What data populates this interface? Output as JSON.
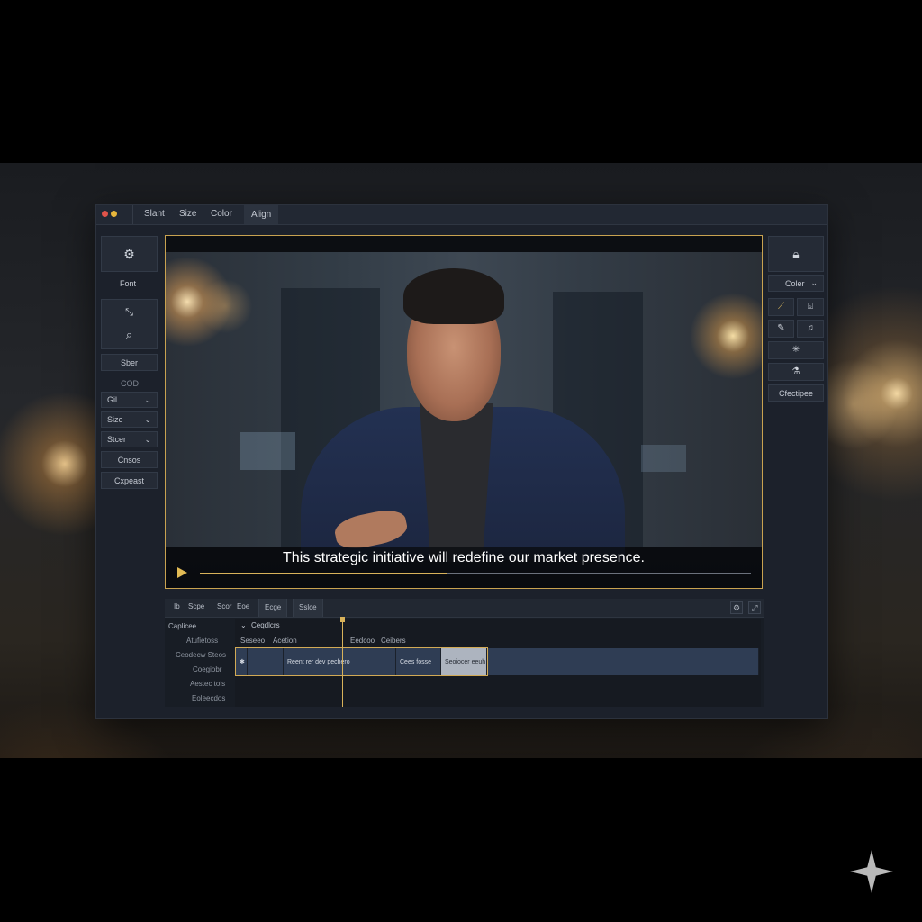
{
  "menu": [
    "Slant",
    "Size",
    "Color",
    "Align"
  ],
  "left_panel": {
    "font_label": "Font",
    "style_button": "Sber",
    "divider_text": "COD",
    "dropdowns": [
      "Gil",
      "Size",
      "Stcer"
    ],
    "cross_button": "Cnsos",
    "export_button": "Cxpeast"
  },
  "video": {
    "caption": "This strategic initiative will redefine our market presence.",
    "progress": 0.45
  },
  "right_panel": {
    "color_label": "Coler",
    "settings_button": "Cfectipee"
  },
  "timeline": {
    "tabs": [
      "Ib",
      "Scpe",
      "Scor",
      "Eoe",
      "Ecge",
      "Sslce"
    ],
    "caption_track": "Ceqdlcrs",
    "labels": [
      "Caplicee",
      "Atufietoss",
      "Ceodecw Steos",
      "Coegiobr",
      "Aestec tois",
      "Eoleecdos"
    ],
    "subheaders": [
      "Seseeo",
      "Acetion",
      "Eedcoo",
      "Ceibers"
    ],
    "clips": [
      "✱",
      "",
      "Reent rer dev pechero",
      "Cees fosse",
      "Seoiocer eeuh",
      ""
    ]
  },
  "colors": {
    "accent": "#d8b25a",
    "panel": "#1c212b",
    "clip": "#2f3d54"
  }
}
